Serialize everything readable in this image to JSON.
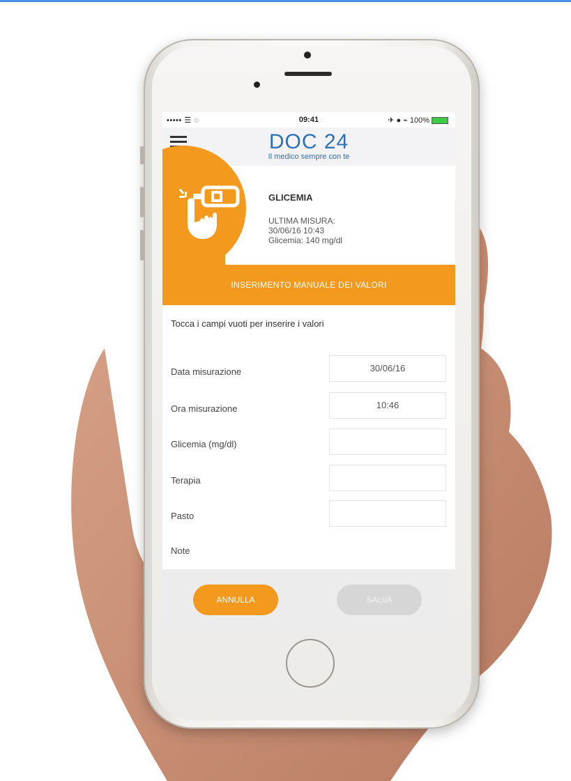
{
  "status_bar": {
    "signal": "••••• ☰ ◌",
    "time": "09:41",
    "right": "✈ ● ⌁ 100%"
  },
  "header": {
    "logo": "DOC 24",
    "tagline": "Il medico sempre con te"
  },
  "card": {
    "title": "GLICEMIA",
    "last_measure_label": "ULTIMA MISURA:",
    "last_measure_datetime": "30/06/16 10:43",
    "last_measure_value": "Glicemia: 140 mg/dl"
  },
  "banner": "INSERIMENTO MANUALE DEI VALORI",
  "hint": "Tocca i campi vuoti per inserire i valori",
  "form": {
    "date_label": "Data misurazione",
    "date_value": "30/06/16",
    "time_label": "Ora misurazione",
    "time_value": "10:46",
    "glycemia_label": "Glicemia (mg/dl)",
    "glycemia_value": "",
    "therapy_label": "Terapia",
    "therapy_value": "",
    "meal_label": "Pasto",
    "meal_value": "",
    "notes_label": "Note"
  },
  "buttons": {
    "cancel": "ANNULLA",
    "save": "SALVA"
  },
  "colors": {
    "accent": "#f39a1e",
    "brand_blue": "#2f6fb3"
  }
}
